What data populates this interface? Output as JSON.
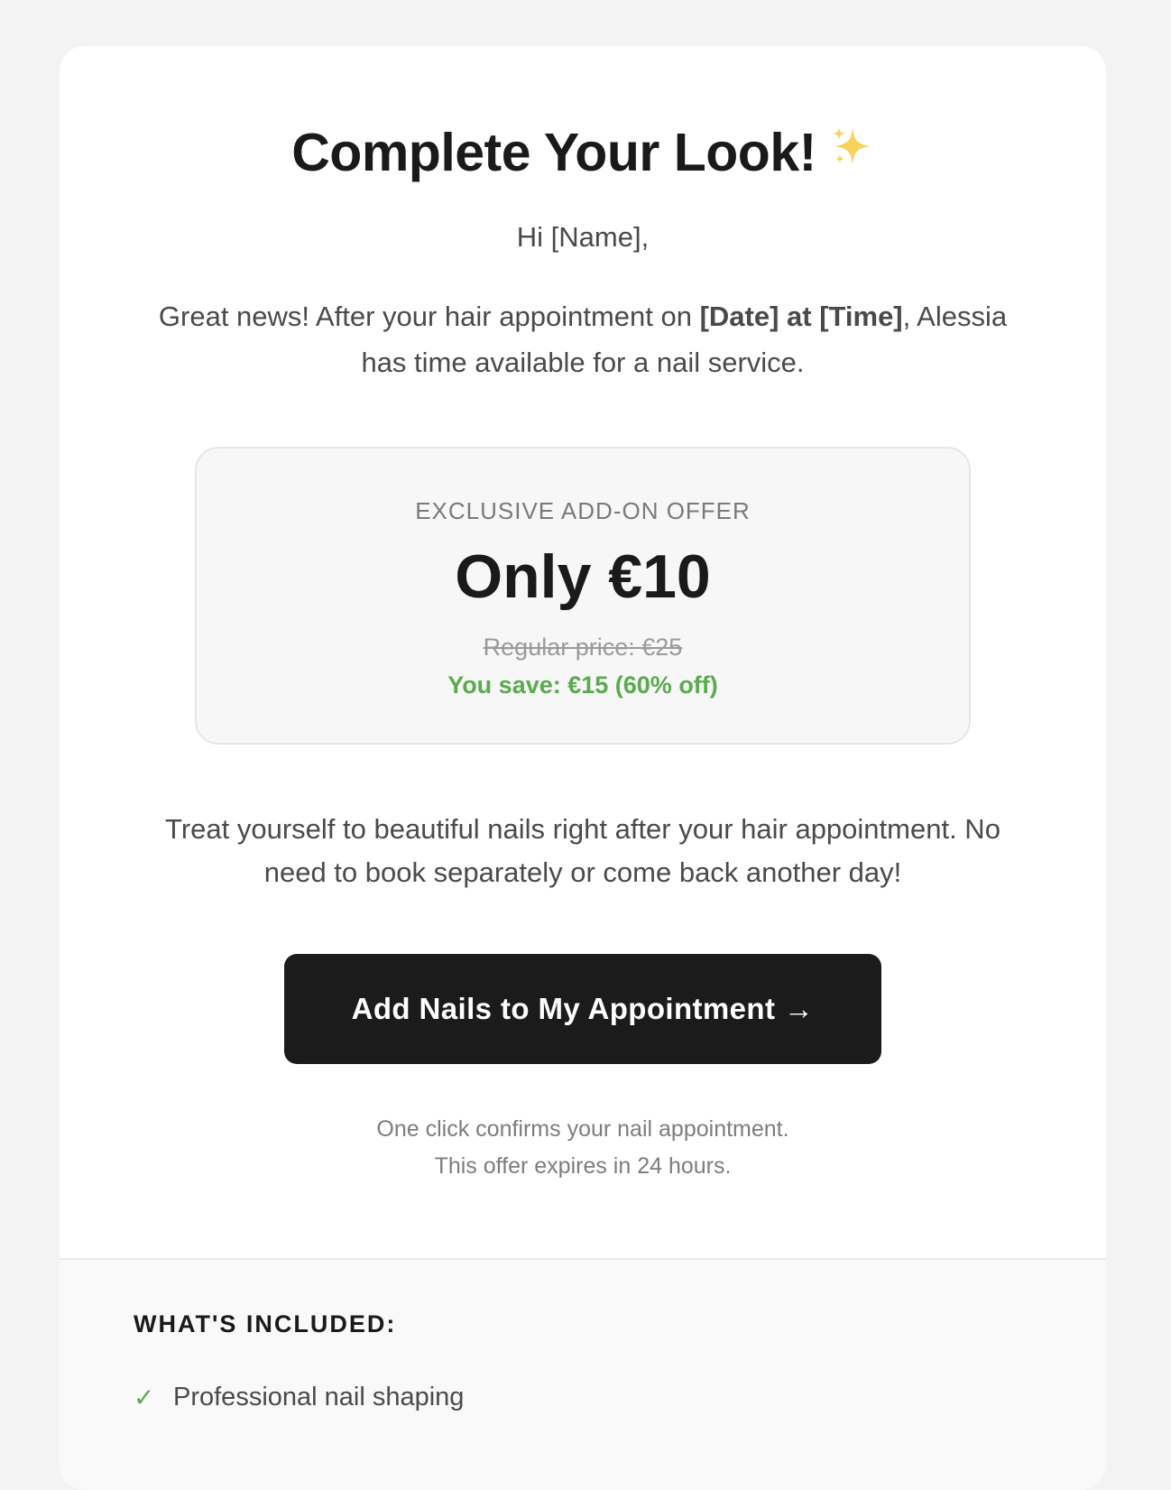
{
  "email": {
    "title": "Complete Your Look!",
    "title_icon": "sparkles-icon",
    "greeting": "Hi [Name],",
    "intro": {
      "before": "Great news! After your hair appointment on ",
      "highlight": "[Date] at [Time]",
      "after": ", Alessia has time available for a nail service."
    },
    "offer": {
      "label": "EXCLUSIVE ADD-ON OFFER",
      "price": "Only €10",
      "regular_price": "Regular price: €25",
      "savings": "You save: €15 (60% off)"
    },
    "body_text": "Treat yourself to beautiful nails right after your hair appointment. No need to book separately or come back another day!",
    "cta_label": "Add Nails to My Appointment →",
    "note_line1": "One click confirms your nail appointment.",
    "note_line2": "This offer expires in 24 hours.",
    "included": {
      "title": "WHAT'S INCLUDED:",
      "items": [
        {
          "icon": "check-icon",
          "check": "✓",
          "label": "Professional nail shaping"
        }
      ]
    }
  },
  "colors": {
    "page_background": "#f3f3f3",
    "card_background": "#ffffff",
    "cta_background": "#1b1b1b",
    "savings_green": "#5aaa4e",
    "offer_background": "#f7f7f7"
  }
}
